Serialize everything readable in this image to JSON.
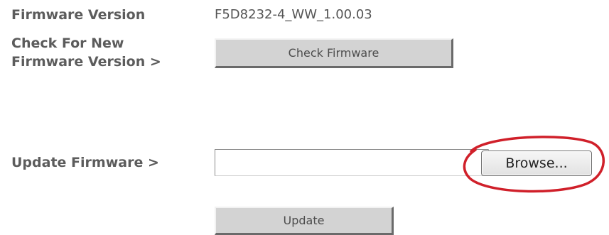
{
  "firmware_version": {
    "label": "Firmware Version",
    "value": "F5D8232-4_WW_1.00.03"
  },
  "check_firmware": {
    "label_line1": "Check For New",
    "label_line2": "Firmware Version >",
    "button_label": "Check Firmware"
  },
  "update_firmware": {
    "label": "Update Firmware >",
    "file_value": "",
    "browse_label": "Browse..."
  },
  "update": {
    "button_label": "Update"
  },
  "colors": {
    "label_text": "#5c5c5c",
    "button_face": "#d3d3d3",
    "highlight_ring": "#d0202a"
  }
}
